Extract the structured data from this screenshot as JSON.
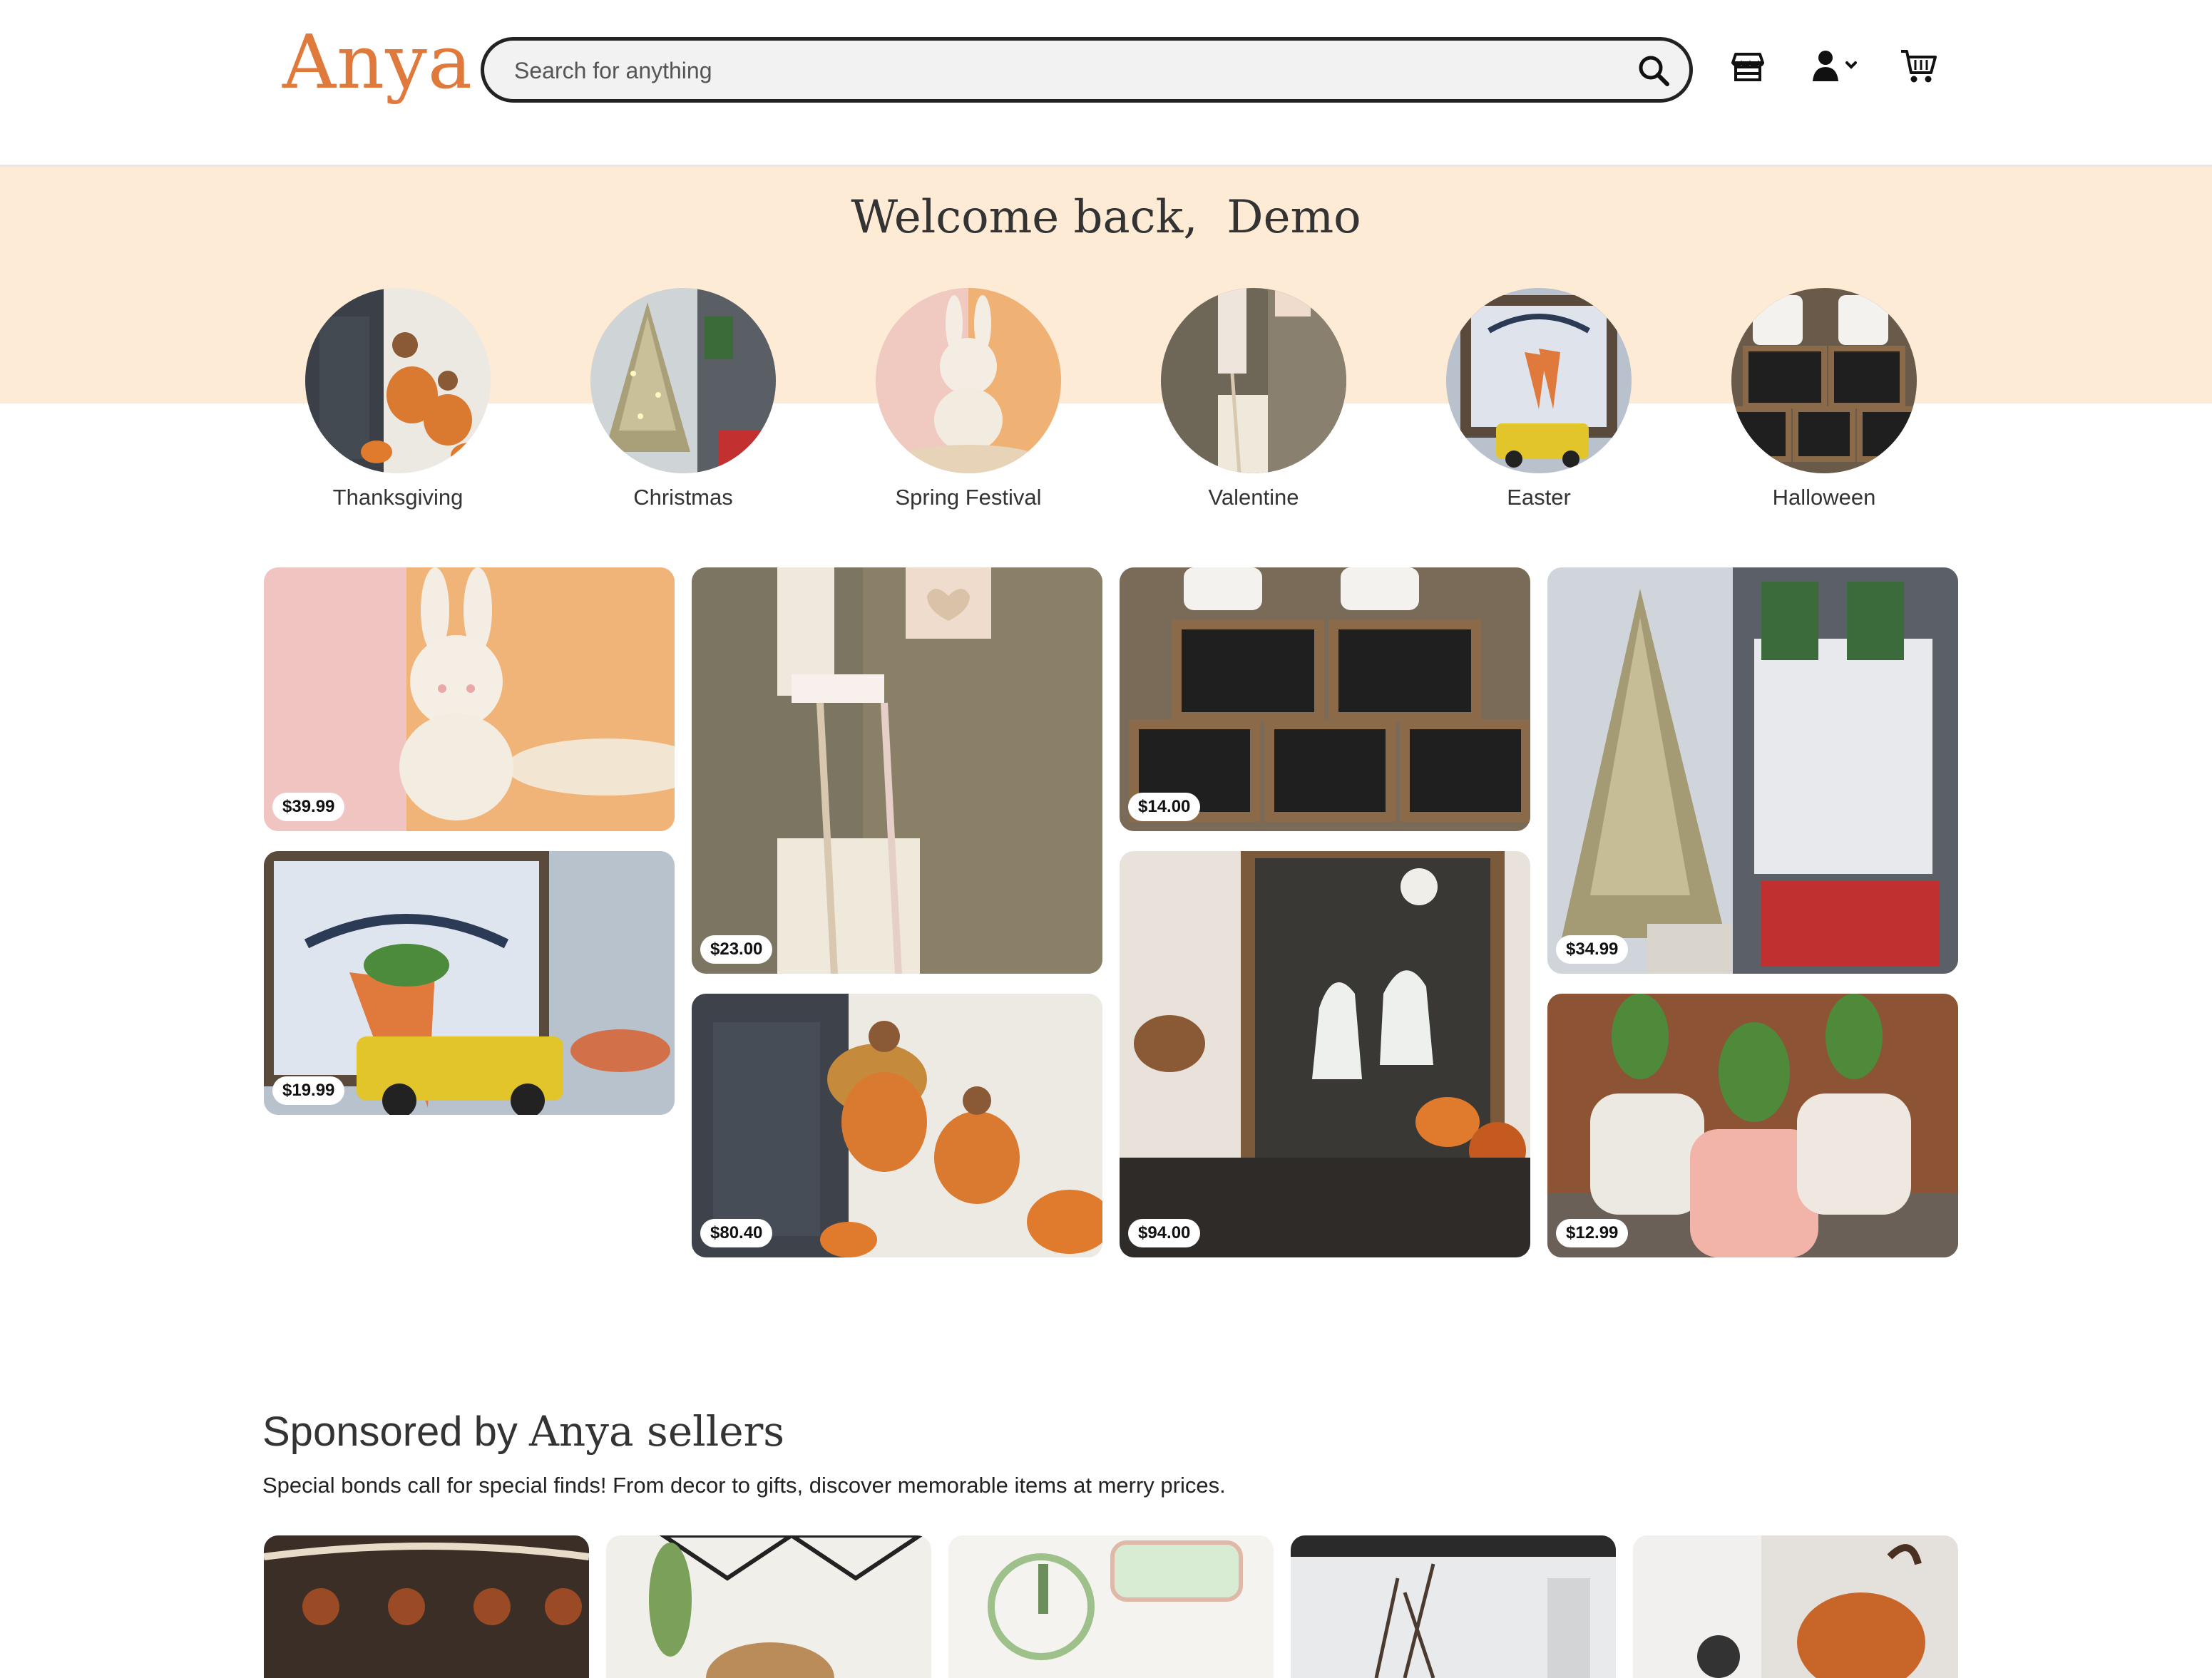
{
  "header": {
    "logo": "Anya",
    "search_placeholder": "Search for anything"
  },
  "banner": {
    "welcome": "Welcome back,  Demo"
  },
  "categories": [
    {
      "label": "Thanksgiving"
    },
    {
      "label": "Christmas"
    },
    {
      "label": "Spring Festival"
    },
    {
      "label": "Valentine"
    },
    {
      "label": "Easter"
    },
    {
      "label": "Halloween"
    }
  ],
  "products": [
    {
      "price": "$39.99",
      "desc": "bunny"
    },
    {
      "price": "$23.00",
      "desc": "love sign"
    },
    {
      "price": "$14.00",
      "desc": "halloween boxes"
    },
    {
      "price": "$34.99",
      "desc": "christmas tree"
    },
    {
      "price": "$19.99",
      "desc": "carrots truck"
    },
    {
      "price": "$80.40",
      "desc": "turkeys"
    },
    {
      "price": "$94.00",
      "desc": "ghost painting"
    },
    {
      "price": "$12.99",
      "desc": "cactus pots"
    }
  ],
  "sponsored": {
    "title_prefix": "Sponsored by ",
    "title_brand": "Anya sellers",
    "subtitle": "Special bonds call for special finds! From decor to gifts, discover memorable items at merry prices."
  },
  "colors": {
    "brand": "#e07a3c",
    "banner": "#fdebd6"
  }
}
